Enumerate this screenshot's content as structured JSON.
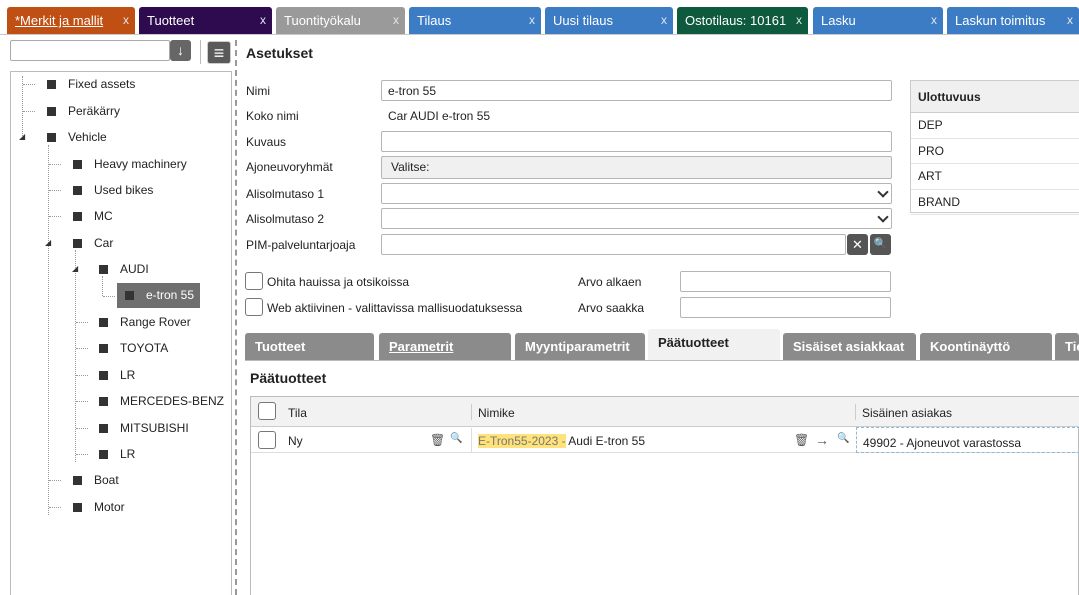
{
  "tabs": [
    {
      "label": "*Merkit ja mallit",
      "close": "x",
      "color": "#c04f14"
    },
    {
      "label": "Tuotteet",
      "close": "x",
      "color": "#2e0a4e"
    },
    {
      "label": "Tuontityökalu",
      "close": "x",
      "color": "#9a9a9a"
    },
    {
      "label": "Tilaus",
      "close": "x",
      "color": "#3c7cc4"
    },
    {
      "label": "Uusi tilaus",
      "close": "x",
      "color": "#3c7cc4"
    },
    {
      "label": "Ostotilaus: 10161",
      "close": "x",
      "color": "#0e5a3e"
    },
    {
      "label": "Lasku",
      "close": "x",
      "color": "#3c7cc4"
    },
    {
      "label": "Laskun toimitus",
      "close": "x",
      "color": "#3c7cc4"
    }
  ],
  "tree": {
    "search_value": "",
    "nodes": [
      {
        "label": "Fixed assets"
      },
      {
        "label": "Peräkärry"
      },
      {
        "label": "Vehicle"
      },
      {
        "label": "Heavy machinery"
      },
      {
        "label": "Used bikes"
      },
      {
        "label": "MC"
      },
      {
        "label": "Car"
      },
      {
        "label": "AUDI"
      },
      {
        "label": "e-tron 55"
      },
      {
        "label": "Range Rover"
      },
      {
        "label": "TOYOTA"
      },
      {
        "label": "LR"
      },
      {
        "label": "MERCEDES-BENZ"
      },
      {
        "label": "MITSUBISHI"
      },
      {
        "label": "LR"
      },
      {
        "label": "Boat"
      },
      {
        "label": "Motor"
      }
    ]
  },
  "settings": {
    "title": "Asetukset",
    "fields": {
      "nimi_label": "Nimi",
      "nimi_value": "e-tron 55",
      "kokonimi_label": "Koko nimi",
      "kokonimi_value": "Car AUDI e-tron 55",
      "kuvaus_label": "Kuvaus",
      "kuvaus_value": "",
      "ajoneuvoryhmat_label": "Ajoneuvoryhmät",
      "ajoneuvoryhmat_value": "Valitse:",
      "alisolmu1_label": "Alisolmutaso 1",
      "alisolmu1_value": "",
      "alisolmu2_label": "Alisolmutaso 2",
      "alisolmu2_value": "",
      "pim_label": "PIM-palveluntarjoaja",
      "pim_value": ""
    },
    "checkboxes": {
      "ohita_label": "Ohita hauissa ja otsikoissa",
      "web_label": "Web aktiivinen - valittavissa mallisuodatuksessa"
    },
    "arvo_alkaen_label": "Arvo alkaen",
    "arvo_saakka_label": "Arvo saakka"
  },
  "dimension": {
    "header": "Ulottuvuus",
    "rows": [
      "DEP",
      "PRO",
      "ART",
      "BRAND"
    ]
  },
  "lower_tabs": [
    "Tuotteet",
    "Parametrit",
    "Myyntiparametrit",
    "Päätuotteet",
    "Sisäiset asiakkaat",
    "Koontinäyttö",
    "Tie"
  ],
  "paatuotteet": {
    "title": "Päätuotteet",
    "columns": [
      "Tila",
      "Nimike",
      "Sisäinen asiakas"
    ],
    "rows": [
      {
        "tila": "Ny",
        "code": "E-Tron55-2023 -",
        "name": " Audi E-tron 55",
        "customer": "49902 - Ajoneuvot varastossa"
      }
    ]
  },
  "icons": {
    "download": "↓",
    "menu": "≡",
    "clear": "✕",
    "search": "🔍",
    "trash": "🗑",
    "arrow": "→"
  }
}
